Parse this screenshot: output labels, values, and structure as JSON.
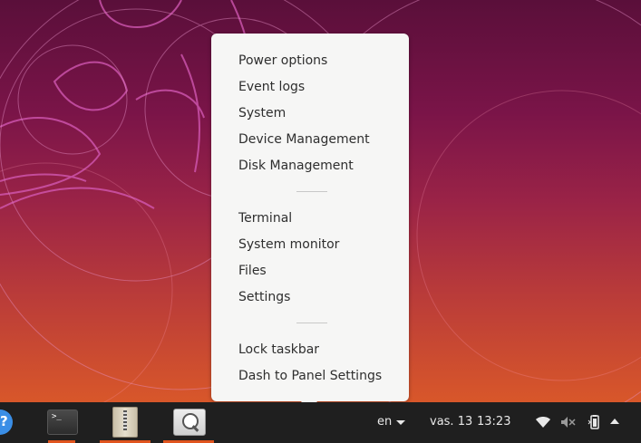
{
  "desktop": {
    "wallpaper": "ubuntu-disco-dingo-wallpaper"
  },
  "menu": {
    "group1": [
      "Power options",
      "Event logs",
      "System",
      "Device Management",
      "Disk Management"
    ],
    "group2": [
      "Terminal",
      "System monitor",
      "Files",
      "Settings"
    ],
    "group3": [
      "Lock taskbar",
      "Dash to Panel Settings"
    ]
  },
  "taskbar": {
    "apps": [
      {
        "icon": "terminal-icon",
        "glyph": ">_"
      },
      {
        "icon": "archive-manager-icon"
      },
      {
        "icon": "image-viewer-icon"
      }
    ],
    "language": "en",
    "date": "vas. 13",
    "time": "13:23",
    "tray_icons": [
      "wifi-icon",
      "volume-muted-icon",
      "battery-icon",
      "tray-expand-icon"
    ]
  },
  "colors": {
    "accent": "#e0541e",
    "menu_bg": "#f6f6f5",
    "taskbar_bg": "#1f1f1f"
  }
}
